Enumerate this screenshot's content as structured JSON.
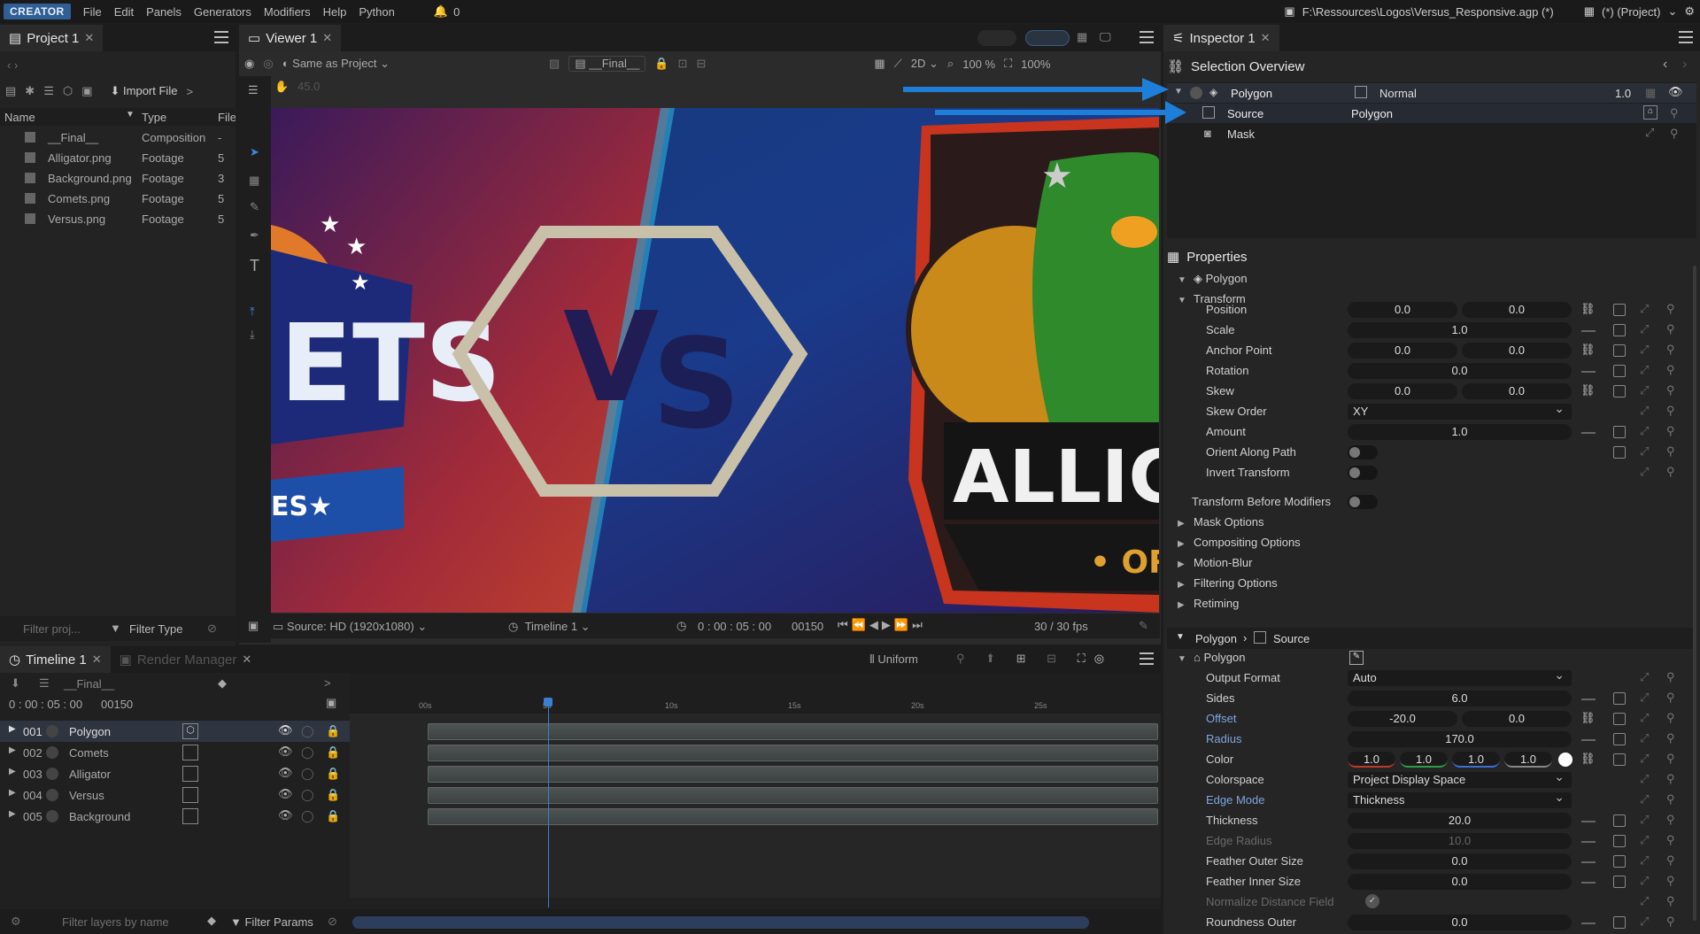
{
  "app": {
    "logo": "CREATOR",
    "menu": [
      "File",
      "Edit",
      "Panels",
      "Generators",
      "Modifiers",
      "Help",
      "Python"
    ],
    "notifications": "0",
    "file_path": "F:\\Ressources\\Logos\\Versus_Responsive.agp (*)",
    "project_mode": "(*) (Project)"
  },
  "project": {
    "tab": "Project 1",
    "import_label": "Import File",
    "columns": [
      "Name",
      "Type",
      "File"
    ],
    "items": [
      {
        "name": "__Final__",
        "type": "Composition",
        "file": "-"
      },
      {
        "name": "Alligator.png",
        "type": "Footage",
        "file": "5"
      },
      {
        "name": "Background.png",
        "type": "Footage",
        "file": "3"
      },
      {
        "name": "Comets.png",
        "type": "Footage",
        "file": "5"
      },
      {
        "name": "Versus.png",
        "type": "Footage",
        "file": "5"
      }
    ],
    "filter_placeholder": "Filter proj...",
    "filter_type": "Filter Type"
  },
  "viewer": {
    "tab": "Viewer 1",
    "color_mode": "Same as Project",
    "comp": "__Final__",
    "view_mode": "2D",
    "zoom": "100 %",
    "zoom2": "100%",
    "source": "Source: HD (1920x1080)",
    "timeline": "Timeline 1",
    "time": "0 : 00 : 05 : 00",
    "frame": "00150",
    "fps": "30 / 30 fps",
    "small_field": "45.0",
    "canvas_text": {
      "vs1": "V",
      "vs2": "S",
      "comets_letters": "ETS",
      "comets_sub": "ES★",
      "allig": "ALLIGA",
      "orla": "• ORLA"
    }
  },
  "timeline": {
    "tab": "Timeline 1",
    "tab2": "Render Manager",
    "comp": "__Final__",
    "uniform": "Uniform",
    "time": "0 : 00 : 05 : 00",
    "frame": "00150",
    "ticks": [
      "00s",
      "5s",
      "10s",
      "15s",
      "20s",
      "25s"
    ],
    "layers": [
      {
        "num": "001",
        "name": "Polygon"
      },
      {
        "num": "002",
        "name": "Comets"
      },
      {
        "num": "003",
        "name": "Alligator"
      },
      {
        "num": "004",
        "name": "Versus"
      },
      {
        "num": "005",
        "name": "Background"
      }
    ],
    "filter_placeholder": "Filter layers by name",
    "filter_params": "Filter Params"
  },
  "inspector": {
    "tab": "Inspector 1",
    "selection_title": "Selection Overview",
    "tree": [
      {
        "label": "Polygon",
        "blend": "Normal",
        "opacity": "1.0"
      },
      {
        "label": "Source",
        "value": "Polygon"
      },
      {
        "label": "Mask"
      }
    ],
    "properties_title": "Properties",
    "obj": "Polygon",
    "transform": "Transform",
    "transform_props": [
      {
        "label": "Position",
        "v1": "0.0",
        "v2": "0.0"
      },
      {
        "label": "Scale",
        "v": "1.0"
      },
      {
        "label": "Anchor Point",
        "v1": "0.0",
        "v2": "0.0"
      },
      {
        "label": "Rotation",
        "v": "0.0"
      },
      {
        "label": "Skew",
        "v1": "0.0",
        "v2": "0.0"
      },
      {
        "label": "Skew Order",
        "drop": "XY"
      },
      {
        "label": "Amount",
        "v": "1.0"
      },
      {
        "label": "Orient Along Path"
      },
      {
        "label": "Invert Transform"
      }
    ],
    "transform_before": "Transform Before Modifiers",
    "sections": [
      "Mask Options",
      "Compositing Options",
      "Motion-Blur",
      "Filtering Options",
      "Retiming"
    ],
    "breadcrumb": [
      "Polygon",
      "Source"
    ],
    "poly": "Polygon",
    "poly_props": [
      {
        "label": "Output Format",
        "drop": "Auto"
      },
      {
        "label": "Sides",
        "v": "6.0"
      },
      {
        "label": "Offset",
        "v1": "-20.0",
        "v2": "0.0"
      },
      {
        "label": "Radius",
        "v": "170.0"
      },
      {
        "label": "Color",
        "c": [
          "1.0",
          "1.0",
          "1.0",
          "1.0"
        ]
      },
      {
        "label": "Colorspace",
        "drop": "Project Display Space"
      },
      {
        "label": "Edge Mode",
        "drop": "Thickness"
      },
      {
        "label": "Thickness",
        "v": "20.0"
      },
      {
        "label": "Edge Radius",
        "v": "10.0"
      },
      {
        "label": "Feather Outer Size",
        "v": "0.0"
      },
      {
        "label": "Feather Inner Size",
        "v": "0.0"
      },
      {
        "label": "Normalize Distance Field"
      },
      {
        "label": "Roundness Outer",
        "v": "0.0"
      }
    ]
  },
  "colors": {
    "accent": "#2f7fd6",
    "arrow": "#1e7fd8",
    "selected_row": "#2e3440"
  }
}
